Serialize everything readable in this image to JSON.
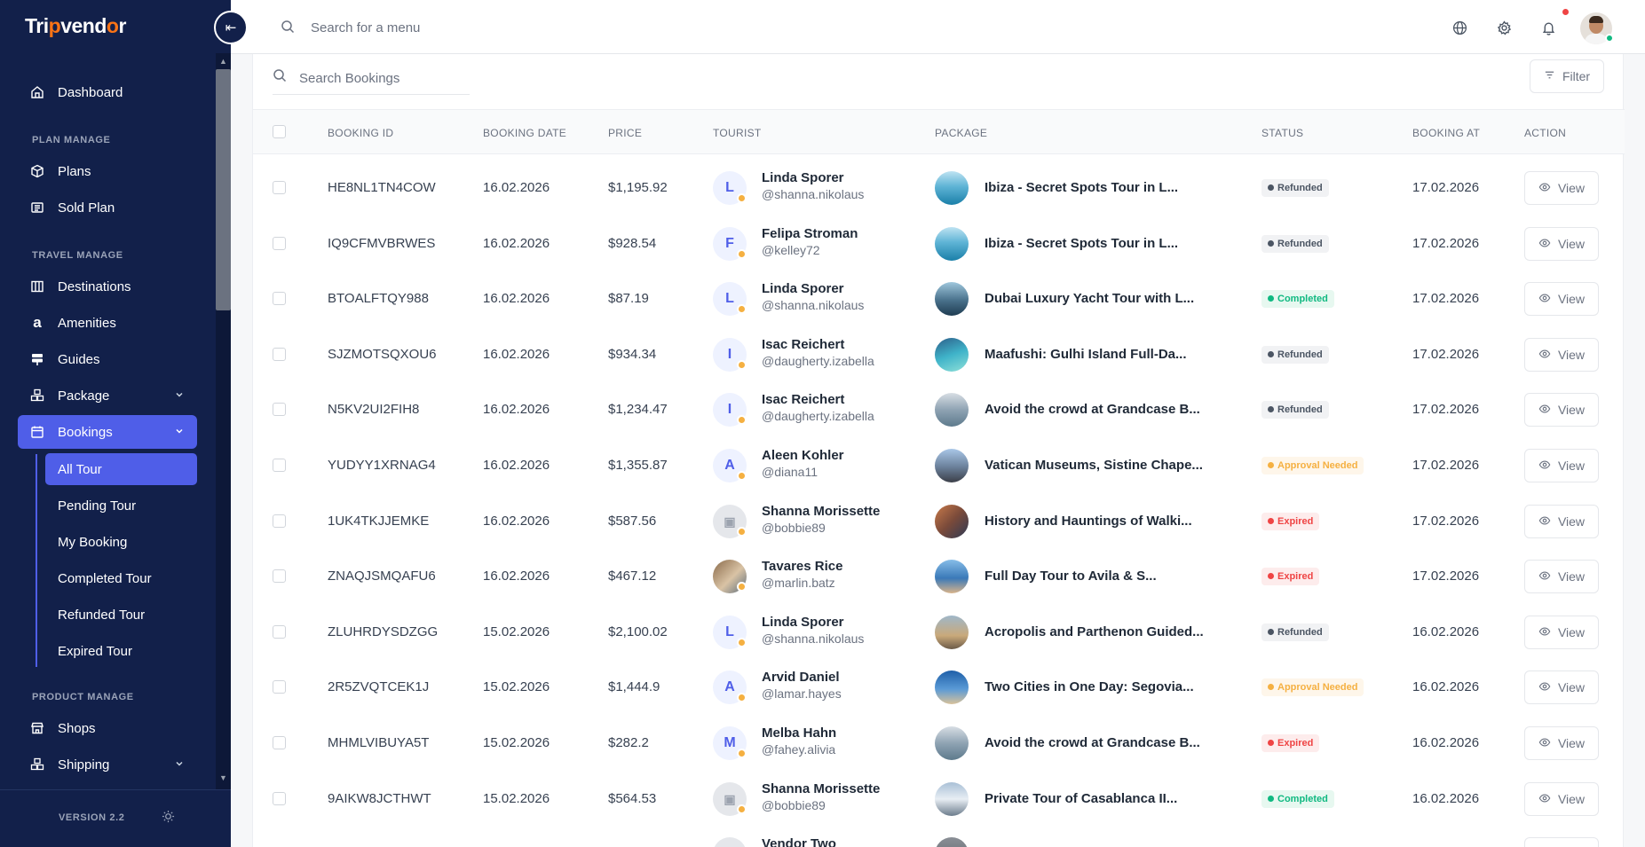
{
  "app": {
    "logo_text_1": "Tri",
    "logo_text_2": "p",
    "logo_text_3": "vend",
    "logo_text_4": "o",
    "logo_text_5": "r",
    "version": "VERSION 2.2"
  },
  "topbar": {
    "search_placeholder": "Search for a menu",
    "icons": [
      "globe-icon",
      "gear-icon",
      "bell-icon"
    ]
  },
  "sidebar": {
    "dashboard": "Dashboard",
    "sections": {
      "plan": "PLAN MANAGE",
      "travel": "TRAVEL MANAGE",
      "product": "PRODUCT MANAGE"
    },
    "items": {
      "plans": "Plans",
      "sold_plan": "Sold Plan",
      "destinations": "Destinations",
      "amenities": "Amenities",
      "guides": "Guides",
      "package": "Package",
      "bookings": "Bookings",
      "shops": "Shops",
      "shipping": "Shipping"
    },
    "sub_items": [
      "All Tour",
      "Pending Tour",
      "My Booking",
      "Completed Tour",
      "Refunded Tour",
      "Expired Tour"
    ]
  },
  "card": {
    "search_placeholder": "Search Bookings",
    "filter_label": "Filter"
  },
  "table": {
    "headers": [
      "BOOKING ID",
      "BOOKING DATE",
      "PRICE",
      "TOURIST",
      "PACKAGE",
      "STATUS",
      "BOOKING AT",
      "ACTION"
    ],
    "view_label": "View",
    "rows": [
      {
        "id": "HE8NL1TN4COW",
        "date": "16.02.2026",
        "price": "$1,195.92",
        "initial": "L",
        "name": "Linda Sporer",
        "handle": "@shanna.nikolaus",
        "package": "Ibiza - Secret Spots Tour in L...",
        "status": "Refunded",
        "booked_at": "17.02.2026"
      },
      {
        "id": "IQ9CFMVBRWES",
        "date": "16.02.2026",
        "price": "$928.54",
        "initial": "F",
        "name": "Felipa Stroman",
        "handle": "@kelley72",
        "package": "Ibiza - Secret Spots Tour in L...",
        "status": "Refunded",
        "booked_at": "17.02.2026"
      },
      {
        "id": "BTOALFTQY988",
        "date": "16.02.2026",
        "price": "$87.19",
        "initial": "L",
        "name": "Linda Sporer",
        "handle": "@shanna.nikolaus",
        "package": "Dubai Luxury Yacht Tour with L...",
        "status": "Completed",
        "booked_at": "17.02.2026"
      },
      {
        "id": "SJZMOTSQXOU6",
        "date": "16.02.2026",
        "price": "$934.34",
        "initial": "I",
        "name": "Isac Reichert",
        "handle": "@daugherty.izabella",
        "package": "Maafushi: Gulhi Island Full-Da...",
        "status": "Refunded",
        "booked_at": "17.02.2026"
      },
      {
        "id": "N5KV2UI2FIH8",
        "date": "16.02.2026",
        "price": "$1,234.47",
        "initial": "I",
        "name": "Isac Reichert",
        "handle": "@daugherty.izabella",
        "package": "Avoid the crowd at Grandcase B...",
        "status": "Refunded",
        "booked_at": "17.02.2026"
      },
      {
        "id": "YUDYY1XRNAG4",
        "date": "16.02.2026",
        "price": "$1,355.87",
        "initial": "A",
        "name": "Aleen Kohler",
        "handle": "@diana11",
        "package": "Vatican Museums, Sistine Chape...",
        "status": "Approval Needed",
        "booked_at": "17.02.2026"
      },
      {
        "id": "1UK4TKJJEMKE",
        "date": "16.02.2026",
        "price": "$587.56",
        "initial": "",
        "name": "Shanna Morissette",
        "handle": "@bobbie89",
        "package": "History and Hauntings of Walki...",
        "status": "Expired",
        "booked_at": "17.02.2026"
      },
      {
        "id": "ZNAQJSMQAFU6",
        "date": "16.02.2026",
        "price": "$467.12",
        "initial": "",
        "name": "Tavares Rice",
        "handle": "@marlin.batz",
        "package": "Full Day Tour to Avila & S...",
        "status": "Expired",
        "booked_at": "17.02.2026"
      },
      {
        "id": "ZLUHRDYSDZGG",
        "date": "15.02.2026",
        "price": "$2,100.02",
        "initial": "L",
        "name": "Linda Sporer",
        "handle": "@shanna.nikolaus",
        "package": "Acropolis and Parthenon Guided...",
        "status": "Refunded",
        "booked_at": "16.02.2026"
      },
      {
        "id": "2R5ZVQTCEK1J",
        "date": "15.02.2026",
        "price": "$1,444.9",
        "initial": "A",
        "name": "Arvid Daniel",
        "handle": "@lamar.hayes",
        "package": "Two Cities in One Day: Segovia...",
        "status": "Approval Needed",
        "booked_at": "16.02.2026"
      },
      {
        "id": "MHMLVIBUYA5T",
        "date": "15.02.2026",
        "price": "$282.2",
        "initial": "M",
        "name": "Melba Hahn",
        "handle": "@fahey.alivia",
        "package": "Avoid the crowd at Grandcase B...",
        "status": "Expired",
        "booked_at": "16.02.2026"
      },
      {
        "id": "9AIKW8JCTHWT",
        "date": "15.02.2026",
        "price": "$564.53",
        "initial": "",
        "name": "Shanna Morissette",
        "handle": "@bobbie89",
        "package": "Private Tour of Casablanca II...",
        "status": "Completed",
        "booked_at": "16.02.2026"
      },
      {
        "id": "",
        "date": "",
        "price": "",
        "initial": "",
        "name": "Vendor Two",
        "handle": "",
        "package": "",
        "status": "",
        "booked_at": ""
      }
    ]
  },
  "colors": {
    "sidebar_bg": "#12204a",
    "accent": "#4f5ee8",
    "refunded": "#4b5563",
    "completed": "#10b981",
    "approval": "#f5b041",
    "expired": "#ef4444"
  }
}
